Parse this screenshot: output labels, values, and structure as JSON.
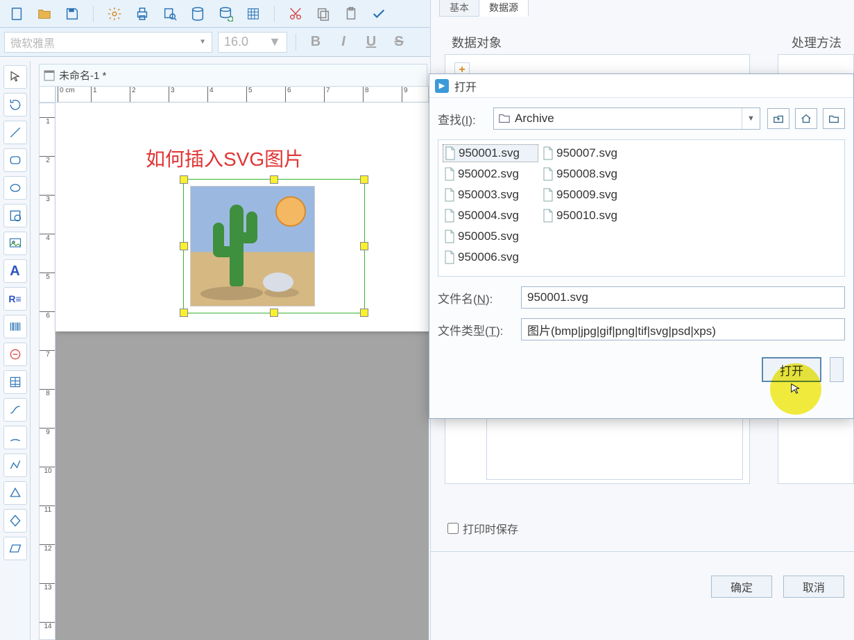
{
  "toolbar": {
    "font_name": "微软雅黑",
    "font_size": "16.0"
  },
  "document": {
    "tab_title": "未命名-1 *",
    "ruler_unit": "0 cm",
    "ruler_marks": [
      "1",
      "2",
      "3",
      "4",
      "5",
      "6",
      "7",
      "8",
      "9"
    ],
    "vruler_marks": [
      "1",
      "2",
      "3",
      "4",
      "5",
      "6",
      "7",
      "8",
      "9",
      "10",
      "11",
      "12",
      "13",
      "14"
    ]
  },
  "canvas": {
    "title_text": "如何插入SVG图片"
  },
  "panel": {
    "tabs": [
      "基本",
      "数据源"
    ],
    "active_tab_index": 1,
    "label_data_object": "数据对象",
    "label_method": "处理方法",
    "save_on_print": "打印时保存",
    "ok": "确定",
    "cancel": "取消"
  },
  "dialog": {
    "title": "打开",
    "lookup_label": "查找(I):",
    "lookup_value": "Archive",
    "files": [
      "950001.svg",
      "950002.svg",
      "950003.svg",
      "950004.svg",
      "950005.svg",
      "950006.svg",
      "950007.svg",
      "950008.svg",
      "950009.svg",
      "950010.svg"
    ],
    "selected_file_index": 0,
    "filename_label": "文件名(N):",
    "filename_value": "950001.svg",
    "filetype_label": "文件类型(T):",
    "filetype_value": "图片(bmp|jpg|gif|png|tif|svg|psd|xps)",
    "open_btn": "打开"
  }
}
